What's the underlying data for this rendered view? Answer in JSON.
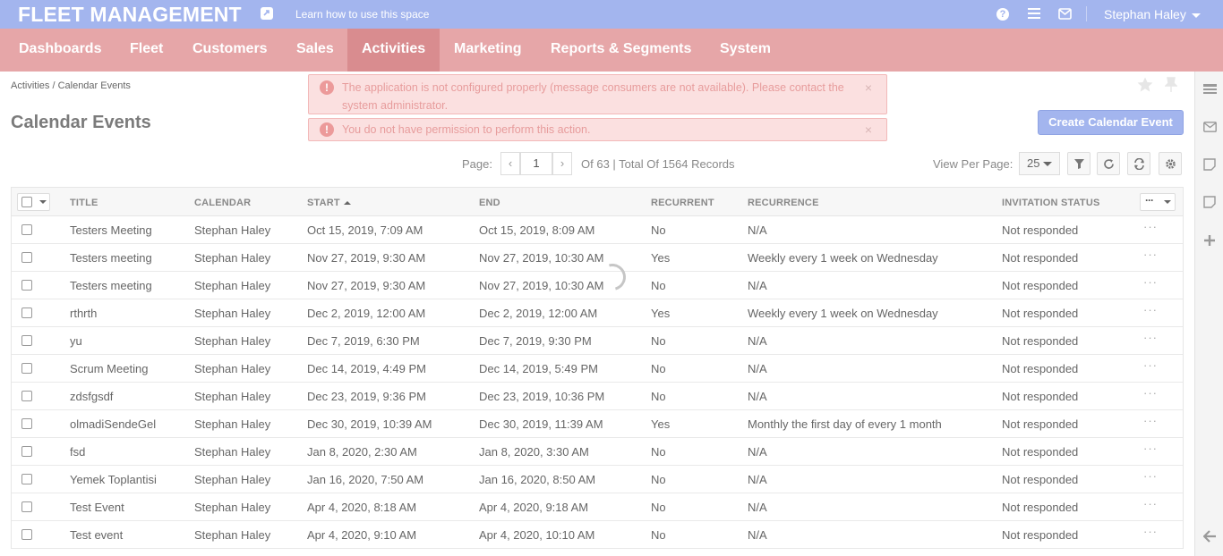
{
  "app": {
    "logo": "FLEET MANAGEMENT",
    "learn_link": "Learn how to use this space",
    "user_name": "Stephan Haley"
  },
  "nav": {
    "items": [
      "Dashboards",
      "Fleet",
      "Customers",
      "Sales",
      "Activities",
      "Marketing",
      "Reports & Segments",
      "System"
    ],
    "active": "Activities"
  },
  "breadcrumb": "Activities / Calendar Events",
  "page_title": "Calendar Events",
  "create_button": "Create Calendar Event",
  "alerts": [
    "The application is not configured properly (message consumers are not available). Please contact the system administrator.",
    "You do not have permission to perform this action."
  ],
  "pager": {
    "label": "Page:",
    "current": "1",
    "info": "Of 63 | Total Of 1564 Records",
    "view_per_page_label": "View Per Page:",
    "view_per_page": "25"
  },
  "table": {
    "columns": [
      "TITLE",
      "CALENDAR",
      "START",
      "END",
      "RECURRENT",
      "RECURRENCE",
      "INVITATION STATUS"
    ],
    "sorted_column": "START",
    "rows": [
      {
        "title": "Testers Meeting",
        "calendar": "Stephan Haley",
        "start": "Oct 15, 2019, 7:09 AM",
        "end": "Oct 15, 2019, 8:09 AM",
        "recurrent": "No",
        "recurrence": "N/A",
        "status": "Not responded"
      },
      {
        "title": "Testers meeting",
        "calendar": "Stephan Haley",
        "start": "Nov 27, 2019, 9:30 AM",
        "end": "Nov 27, 2019, 10:30 AM",
        "recurrent": "Yes",
        "recurrence": "Weekly every 1 week on Wednesday",
        "status": "Not responded"
      },
      {
        "title": "Testers meeting",
        "calendar": "Stephan Haley",
        "start": "Nov 27, 2019, 9:30 AM",
        "end": "Nov 27, 2019, 10:30 AM",
        "recurrent": "No",
        "recurrence": "N/A",
        "status": "Not responded"
      },
      {
        "title": "rthrth",
        "calendar": "Stephan Haley",
        "start": "Dec 2, 2019, 12:00 AM",
        "end": "Dec 2, 2019, 12:00 AM",
        "recurrent": "Yes",
        "recurrence": "Weekly every 1 week on Wednesday",
        "status": "Not responded"
      },
      {
        "title": "yu",
        "calendar": "Stephan Haley",
        "start": "Dec 7, 2019, 6:30 PM",
        "end": "Dec 7, 2019, 9:30 PM",
        "recurrent": "No",
        "recurrence": "N/A",
        "status": "Not responded"
      },
      {
        "title": "Scrum Meeting",
        "calendar": "Stephan Haley",
        "start": "Dec 14, 2019, 4:49 PM",
        "end": "Dec 14, 2019, 5:49 PM",
        "recurrent": "No",
        "recurrence": "N/A",
        "status": "Not responded"
      },
      {
        "title": "zdsfgsdf",
        "calendar": "Stephan Haley",
        "start": "Dec 23, 2019, 9:36 PM",
        "end": "Dec 23, 2019, 10:36 PM",
        "recurrent": "No",
        "recurrence": "N/A",
        "status": "Not responded"
      },
      {
        "title": "olmadiSendeGel",
        "calendar": "Stephan Haley",
        "start": "Dec 30, 2019, 10:39 AM",
        "end": "Dec 30, 2019, 11:39 AM",
        "recurrent": "Yes",
        "recurrence": "Monthly the first day of every 1 month",
        "status": "Not responded"
      },
      {
        "title": "fsd",
        "calendar": "Stephan Haley",
        "start": "Jan 8, 2020, 2:30 AM",
        "end": "Jan 8, 2020, 3:30 AM",
        "recurrent": "No",
        "recurrence": "N/A",
        "status": "Not responded"
      },
      {
        "title": "Yemek Toplantisi",
        "calendar": "Stephan Haley",
        "start": "Jan 16, 2020, 7:50 AM",
        "end": "Jan 16, 2020, 8:50 AM",
        "recurrent": "No",
        "recurrence": "N/A",
        "status": "Not responded"
      },
      {
        "title": "Test Event",
        "calendar": "Stephan Haley",
        "start": "Apr 4, 2020, 8:18 AM",
        "end": "Apr 4, 2020, 9:18 AM",
        "recurrent": "No",
        "recurrence": "N/A",
        "status": "Not responded"
      },
      {
        "title": "Test event",
        "calendar": "Stephan Haley",
        "start": "Apr 4, 2020, 9:10 AM",
        "end": "Apr 4, 2020, 10:10 AM",
        "recurrent": "No",
        "recurrence": "N/A",
        "status": "Not responded"
      }
    ]
  },
  "icons": {
    "learn": "share-icon",
    "help": "question-icon",
    "menu": "hamburger-icon",
    "mail": "envelope-icon",
    "star": "star-icon",
    "pin": "pin-icon",
    "filter": "filter-icon",
    "refresh": "refresh-icon",
    "reset": "reset-icon",
    "settings": "gear-icon"
  },
  "colors": {
    "topbar": "#a3b5ee",
    "navbar": "#e6a6a8",
    "nav_active": "#d98c8f",
    "alert_bg": "#fbe0e0",
    "button": "#a3b5ee"
  }
}
